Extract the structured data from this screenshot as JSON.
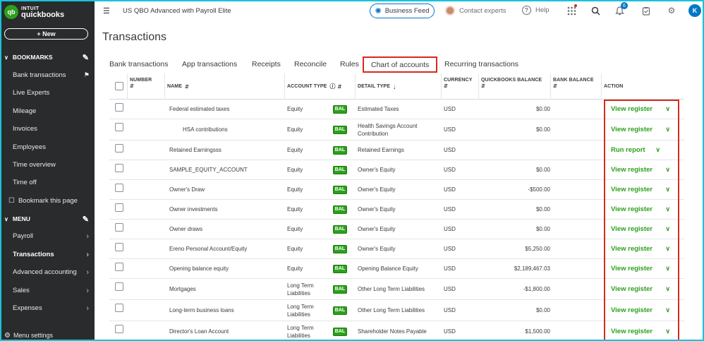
{
  "sidebar": {
    "logo_brand": "INTUIT",
    "logo_product": "quickbooks",
    "logo_mark": "qb",
    "new_button": "+ New",
    "bookmarks_header": "BOOKMARKS",
    "bookmarks": [
      "Bank transactions",
      "Live Experts",
      "Mileage",
      "Invoices",
      "Employees",
      "Time overview",
      "Time off"
    ],
    "bookmark_this_page": "Bookmark this page",
    "menu_header": "MENU",
    "menu_items": [
      "Payroll",
      "Transactions",
      "Advanced accounting",
      "Sales",
      "Expenses"
    ],
    "menu_settings": "Menu settings"
  },
  "header": {
    "company": "US QBO Advanced with Payroll Elite",
    "business_feed": "Business Feed",
    "contact_experts": "Contact experts",
    "help": "Help",
    "notification_count": "6",
    "user_initial": "K"
  },
  "page": {
    "title": "Transactions",
    "tabs": [
      "Bank transactions",
      "App transactions",
      "Receipts",
      "Reconcile",
      "Rules",
      "Chart of accounts",
      "Recurring transactions"
    ],
    "active_tab": "Chart of accounts"
  },
  "table": {
    "headers": {
      "number": "NUMBER",
      "name": "NAME",
      "account_type": "ACCOUNT TYPE",
      "detail_type": "DETAIL TYPE",
      "currency": "CURRENCY",
      "qb_balance": "QUICKBOOKS BALANCE",
      "bank_balance": "BANK BALANCE",
      "action": "ACTION"
    },
    "badge": "BAL",
    "rows": [
      {
        "name": "Federal estimated taxes",
        "type": "Equity",
        "detail": "Estimated Taxes",
        "currency": "USD",
        "balance": "$0.00",
        "action": "View register"
      },
      {
        "name": "HSA contributions",
        "type": "Equity",
        "detail": "Health Savings Account Contribution",
        "currency": "USD",
        "balance": "$0.00",
        "action": "View register"
      },
      {
        "name": "Retained Earningsss",
        "type": "Equity",
        "detail": "Retained Earnings",
        "currency": "USD",
        "balance": "",
        "action": "Run report"
      },
      {
        "name": "SAMPLE_EQUITY_ACCOUNT",
        "type": "Equity",
        "detail": "Owner's Equity",
        "currency": "USD",
        "balance": "$0.00",
        "action": "View register"
      },
      {
        "name": "Owner's Draw",
        "type": "Equity",
        "detail": "Owner's Equity",
        "currency": "USD",
        "balance": "-$500.00",
        "action": "View register"
      },
      {
        "name": "Owner investments",
        "type": "Equity",
        "detail": "Owner's Equity",
        "currency": "USD",
        "balance": "$0.00",
        "action": "View register"
      },
      {
        "name": "Owner draws",
        "type": "Equity",
        "detail": "Owner's Equity",
        "currency": "USD",
        "balance": "$0.00",
        "action": "View register"
      },
      {
        "name": "Ereno Personal Account/Equity",
        "type": "Equity",
        "detail": "Owner's Equity",
        "currency": "USD",
        "balance": "$5,250.00",
        "action": "View register"
      },
      {
        "name": "Opening balance equity",
        "type": "Equity",
        "detail": "Opening Balance Equity",
        "currency": "USD",
        "balance": "$2,189,467.03",
        "action": "View register"
      },
      {
        "name": "Mortgages",
        "type": "Long Term Liabilities",
        "detail": "Other Long Term Liabilities",
        "currency": "USD",
        "balance": "-$1,800.00",
        "action": "View register"
      },
      {
        "name": "Long-term business loans",
        "type": "Long Term Liabilities",
        "detail": "Other Long Term Liabilities",
        "currency": "USD",
        "balance": "$0.00",
        "action": "View register"
      },
      {
        "name": "Director's Loan Account",
        "type": "Long Term Liabilities",
        "detail": "Shareholder Notes Payable",
        "currency": "USD",
        "balance": "$1,500.00",
        "action": "View register"
      }
    ]
  }
}
